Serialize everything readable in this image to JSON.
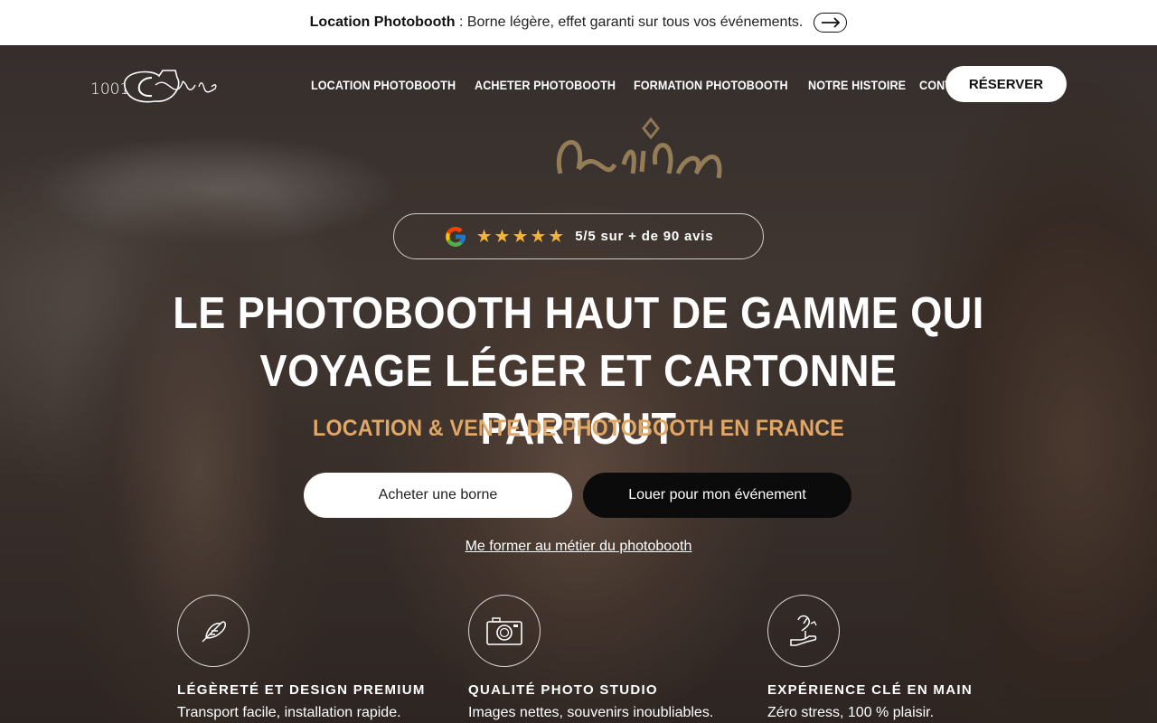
{
  "announcement": {
    "bold": "Location Photobooth",
    "text": " : Borne légère, effet garanti sur tous vos événements."
  },
  "nav": {
    "logo_text": "1001 Selfie",
    "links": [
      "LOCATION PHOTOBOOTH",
      "ACHETER PHOTOBOOTH",
      "FORMATION PHOTOBOOTH",
      "NOTRE HISTOIRE",
      "CONTACT"
    ],
    "cta": "RÉSERVER"
  },
  "reviews": {
    "stars": "★★★★★",
    "text": "5/5 sur + de 90 avis"
  },
  "hero": {
    "headline_line1": "LE PHOTOBOOTH HAUT DE GAMME QUI",
    "headline_line2": "VOYAGE LÉGER ET CARTONNE PARTOUT",
    "subhead": "LOCATION & VENTE DE PHOTOBOOTH EN FRANCE",
    "btn_buy": "Acheter une borne",
    "btn_rent": "Louer pour mon événement",
    "link_train": "Me former au métier du photobooth"
  },
  "features": [
    {
      "icon": "feather-icon",
      "title": "LÉGÈRETÉ ET DESIGN PREMIUM",
      "desc": "Transport facile, installation rapide."
    },
    {
      "icon": "camera-icon",
      "title": "QUALITÉ PHOTO STUDIO",
      "desc": "Images nettes, souvenirs inoubliables."
    },
    {
      "icon": "hand-gift-icon",
      "title": "EXPÉRIENCE CLÉ EN MAIN",
      "desc": "Zéro stress, 100 % plaisir."
    }
  ],
  "colors": {
    "accent": "#e0a767",
    "star": "#f0b43c",
    "dark_button": "#0b0b0b"
  }
}
